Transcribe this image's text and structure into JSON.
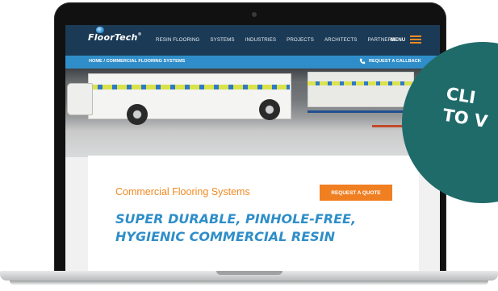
{
  "header": {
    "logo_text": "FloorTech",
    "logo_mark": "®",
    "nav": [
      "RESIN FLOORING",
      "SYSTEMS",
      "INDUSTRIES",
      "PROJECTS",
      "ARCHITECTS",
      "PARTNERS"
    ],
    "menu_label": "MENU"
  },
  "subbar": {
    "breadcrumb": "HOME / COMMERCIAL FLOORING SYSTEMS",
    "callback_label": "REQUEST A CALLBACK",
    "callback_icon": "phone-icon"
  },
  "hero": {
    "description_icon": "hero-image"
  },
  "content": {
    "subtitle": "Commercial Flooring Systems",
    "quote_button": "REQUEST A QUOTE",
    "headline_line1": "SUPER DURABLE, PINHOLE-FREE,",
    "headline_line2": "HYGIENIC COMMERCIAL RESIN"
  },
  "cta": {
    "text": "CLI\nTO V"
  },
  "colors": {
    "header_bg": "#1b3a55",
    "subbar_bg": "#2f8ec9",
    "accent_orange": "#f07f22",
    "headline_blue": "#2f8ec9",
    "cta_teal": "#1f6b6a"
  }
}
